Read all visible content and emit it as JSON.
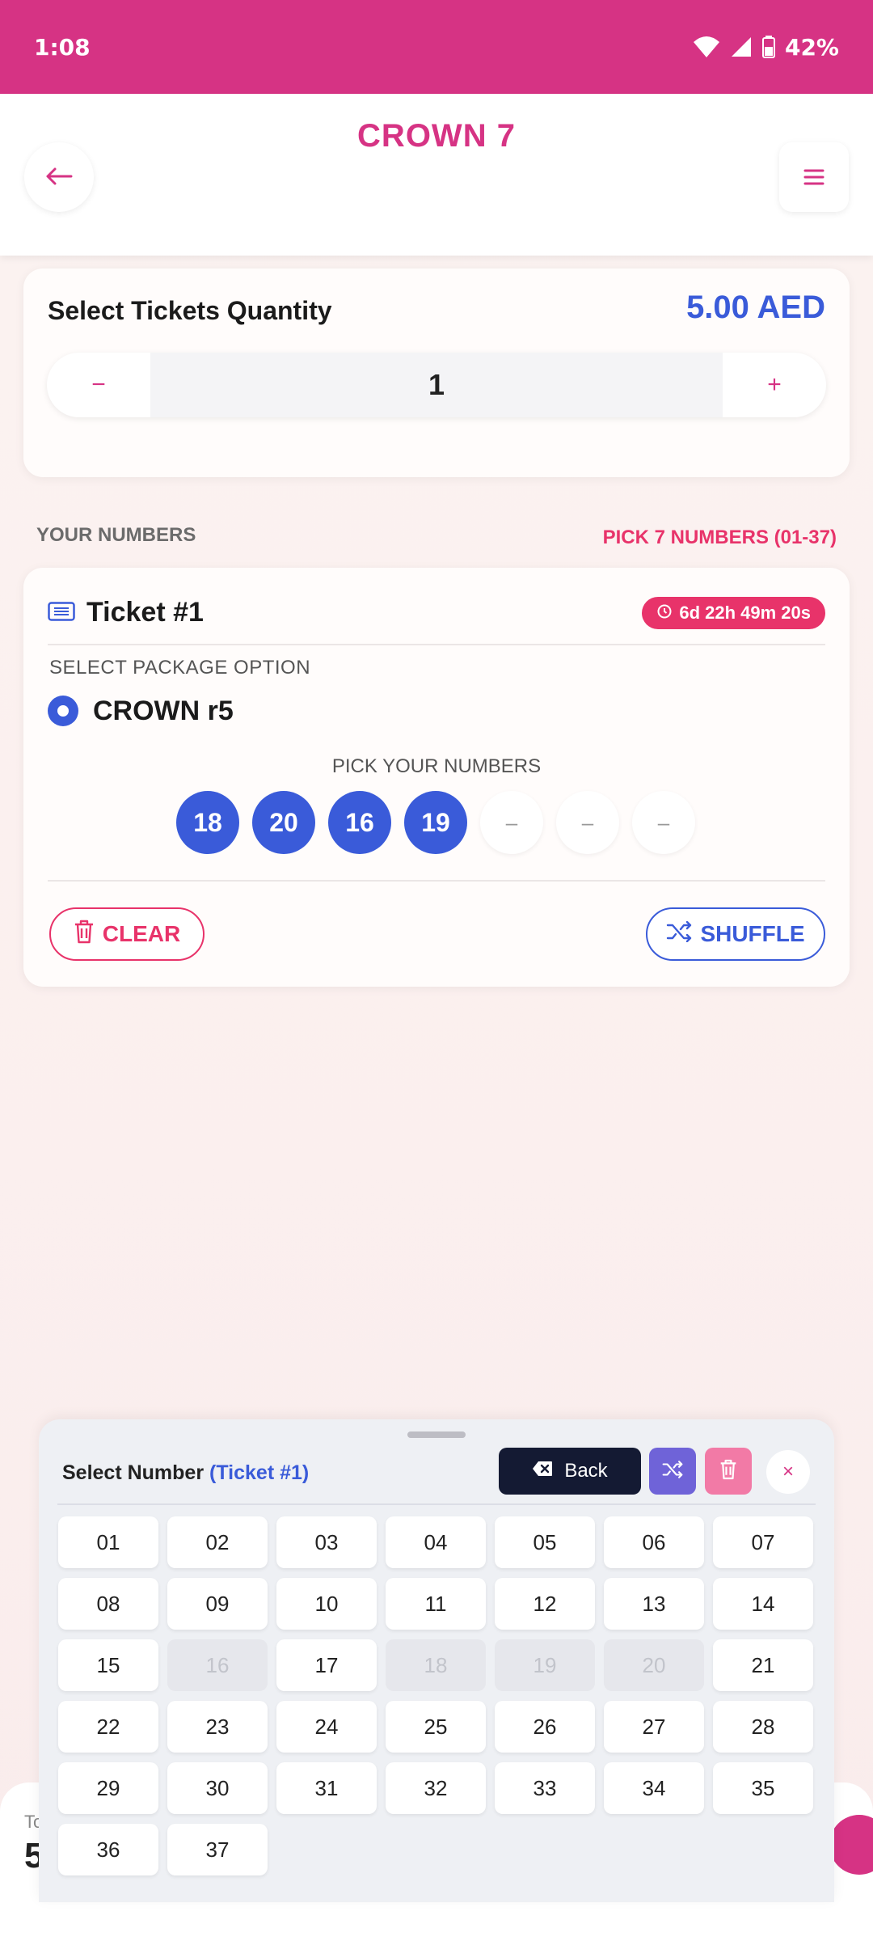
{
  "status_bar": {
    "time": "1:08",
    "battery": "42%"
  },
  "header": {
    "title": "CROWN 7"
  },
  "quantity": {
    "title": "Select Tickets Quantity",
    "price": "5.00 AED",
    "minus": "−",
    "plus": "+",
    "value": "1"
  },
  "section": {
    "your_numbers": "YOUR NUMBERS",
    "pick_hint": "PICK 7 NUMBERS (01-37)"
  },
  "ticket": {
    "title": "Ticket #1",
    "timer": "6d 22h 49m 20s",
    "package_label": "SELECT PACKAGE OPTION",
    "package_name": "CROWN r5",
    "pick_label": "PICK YOUR NUMBERS",
    "balls": [
      "18",
      "20",
      "16",
      "19",
      "–",
      "–",
      "–"
    ],
    "clear_label": "CLEAR",
    "shuffle_label": "SHUFFLE"
  },
  "total_bar": {
    "label": "To",
    "value": "5"
  },
  "picker": {
    "title": "Select Number",
    "title_accent": "(Ticket #1)",
    "back_label": "Back",
    "close": "×",
    "numbers": [
      "01",
      "02",
      "03",
      "04",
      "05",
      "06",
      "07",
      "08",
      "09",
      "10",
      "11",
      "12",
      "13",
      "14",
      "15",
      "16",
      "17",
      "18",
      "19",
      "20",
      "21",
      "22",
      "23",
      "24",
      "25",
      "26",
      "27",
      "28",
      "29",
      "30",
      "31",
      "32",
      "33",
      "34",
      "35",
      "36",
      "37"
    ],
    "disabled": [
      "16",
      "18",
      "19",
      "20"
    ]
  },
  "colors": {
    "brand": "#d63384",
    "accent_blue": "#3a5bd9",
    "alert": "#e8336a"
  }
}
